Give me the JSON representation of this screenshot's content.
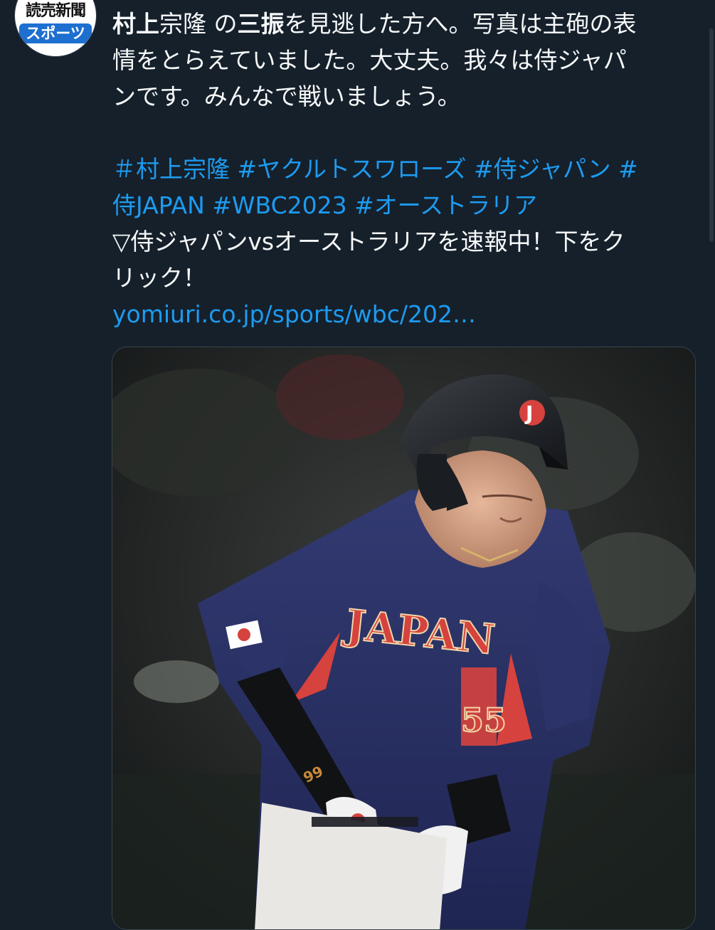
{
  "author": {
    "avatar_text_top": "読売新聞",
    "avatar_text_bottom": "スポーツ"
  },
  "tweet": {
    "line1": {
      "name_bold": "村上",
      "name_rest": "宗隆",
      "mid1": " の",
      "strikeout_bold": "三振",
      "rest": "を見逃した方へ。写真は主砲の表"
    },
    "line2": "情をとらえていました。大丈夫。我々は侍ジャパ",
    "line3": "ンです。みんなで戦いましょう。",
    "hashtag_line1": "＃村上宗隆 #ヤクルトスワローズ #侍ジャパン #",
    "hashtag_line2": "侍JAPAN #WBC2023 #オーストラリア",
    "promo_line1": "▽侍ジャパンvsオーストラリアを速報中！下をク",
    "promo_line2": "リック！",
    "link": "yomiuri.co.jp/sports/wbc/202…"
  },
  "media": {
    "helmet_letter": "J",
    "jersey_text": "JAPAN",
    "jersey_number": "55",
    "sleeve_number": "99"
  },
  "colors": {
    "background": "#15202b",
    "text": "#f7f9f9",
    "link": "#1d9bf0",
    "jersey_navy": "#2a3264",
    "jersey_red": "#d6423e"
  },
  "icons": {
    "scrollbar": "scrollbar-thumb"
  }
}
